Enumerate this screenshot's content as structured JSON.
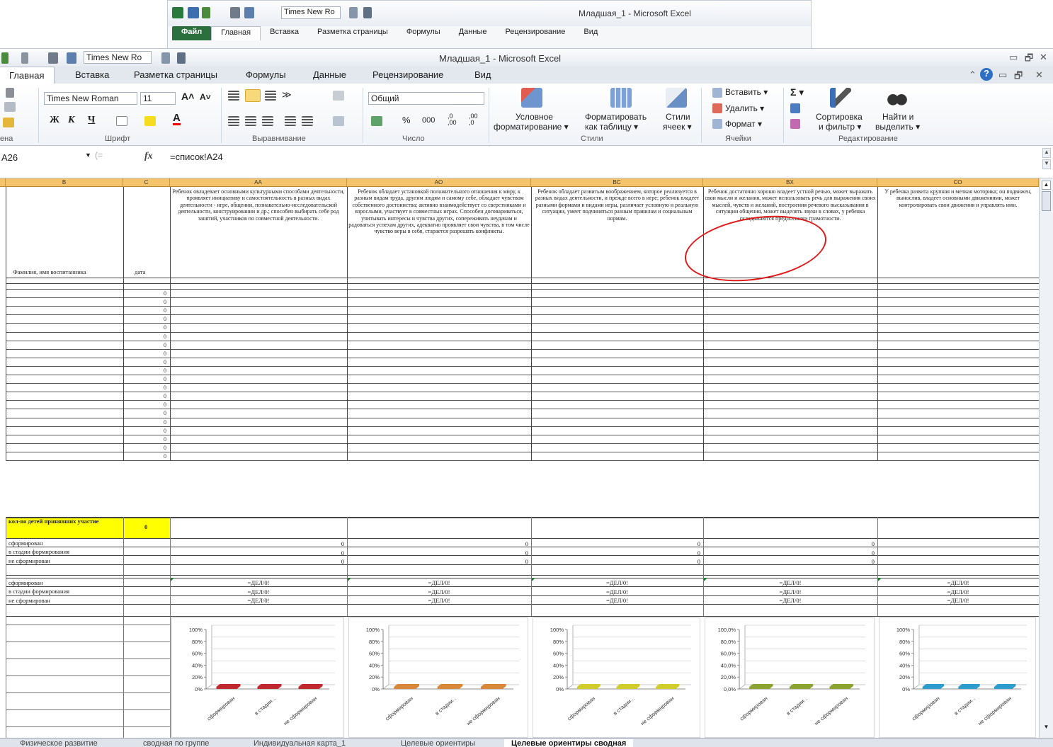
{
  "bg_window": {
    "title": "Младшая_1 - Microsoft Excel",
    "font": "Times New Ro",
    "tabs": [
      "Файл",
      "Главная",
      "Вставка",
      "Разметка страницы",
      "Формулы",
      "Данные",
      "Рецензирование",
      "Вид"
    ]
  },
  "window": {
    "title": "Младшая_1 - Microsoft Excel",
    "qat_font": "Times New Ro"
  },
  "ribbon_tabs": [
    "Главная",
    "Вставка",
    "Разметка страницы",
    "Формулы",
    "Данные",
    "Рецензирование",
    "Вид"
  ],
  "ribbon": {
    "clipboard_label": "ена",
    "font_name": "Times New Roman",
    "font_size": "11",
    "bold": "Ж",
    "italic": "К",
    "underline": "Ч",
    "font_group": "Шрифт",
    "align_group": "Выравнивание",
    "number_format": "Общий",
    "percent": "%",
    "thousands": "000",
    "number_group": "Число",
    "cond_format_1": "Условное",
    "cond_format_2": "форматирование ▾",
    "as_table_1": "Форматировать",
    "as_table_2": "как таблицу ▾",
    "cell_styles_1": "Стили",
    "cell_styles_2": "ячеек ▾",
    "styles_group": "Стили",
    "insert": "Вставить ▾",
    "delete": "Удалить ▾",
    "format": "Формат ▾",
    "cells_group": "Ячейки",
    "sigma": "Σ ▾",
    "sort_1": "Сортировка",
    "sort_2": "и фильтр ▾",
    "find_1": "Найти и",
    "find_2": "выделить ▾",
    "editing_group": "Редактирование"
  },
  "formula_bar": {
    "name_box": "A26",
    "fx": "fx",
    "formula": "=список!A24"
  },
  "columns": [
    {
      "id": "B",
      "header": "B"
    },
    {
      "id": "C",
      "header": "C"
    },
    {
      "id": "AA",
      "header": "AA",
      "text": "Ребенок овладевает основными культурными способами деятельности, проявляет инициативу и самостоятельность в разных видах деятельности - игре, общении, познавательно-исследовательской деятельности, конструировании и др.; способен выбирать себе род занятий, участников по совместной деятельности."
    },
    {
      "id": "AO",
      "header": "AO",
      "text": "Ребенок обладает установкой положительного отношения к миру, к разным видам труда, другим людям и самому себе, обладает чувством собственного достоинства; активно взаимодействует со сверстниками и взрослыми, участвует в совместных играх. Способен договариваться, учитывать интересы и чувства других, сопереживать неудачам и радоваться успехам других, адекватно проявляет свои чувства, в том числе чувство веры в себя, старается разрешать конфликты."
    },
    {
      "id": "BC",
      "header": "BC",
      "text": "Ребенок обладает развитым воображением, которое реализуется в разных видах деятельности, и прежде всего в игре; ребенок владеет разными формами и видами игры, различает условную и реальную ситуации, умеет подчиняться разным правилам и социальным нормам."
    },
    {
      "id": "BX",
      "header": "BX",
      "text": "Ребенок достаточно хорошо владеет устной речью, может выражать свои мысли и желания, может использовать речь для выражения своих мыслей, чувств и желаний, построения речевого высказывания в ситуации общения, может выделять звуки в словах, у ребенка складываются предпосылки грамотности."
    },
    {
      "id": "CO",
      "header": "CO",
      "text": "У ребенка развита крупная и мелкая моторика; он подвижен, вынослив, владеет основными движениями, может контролировать свои движения и управлять ими."
    }
  ],
  "header_labels": {
    "name_col": "Фамилия, имя воспитанника",
    "date_col": "дата"
  },
  "zero_values": [
    "0",
    "0",
    "0",
    "0",
    "0",
    "0",
    "0",
    "0",
    "0",
    "0",
    "0",
    "0",
    "0",
    "0",
    "0",
    "0",
    "0",
    "0",
    "0",
    "0"
  ],
  "summary": {
    "count_label": "кол-во детей принявших участие",
    "count_value": "0",
    "rows": [
      {
        "label": "сформирован",
        "value": "0"
      },
      {
        "label": "в стадии формирования",
        "value": "0"
      },
      {
        "label": "не сформирован",
        "value": "0"
      }
    ],
    "pct_rows": [
      {
        "label": "сформирован",
        "value": "=ДЕЛ/0!"
      },
      {
        "label": "в стадии формирования",
        "value": "=ДЕЛ/0!"
      },
      {
        "label": "не сформирован",
        "value": "=ДЕЛ/0!"
      }
    ]
  },
  "chart_data": [
    {
      "type": "bar",
      "categories": [
        "сформирован",
        "в стадии...",
        "не сформирован"
      ],
      "values": [
        0,
        0,
        0
      ],
      "ylim": [
        0,
        100
      ],
      "yticks": [
        "100%",
        "80%",
        "60%",
        "40%",
        "20%",
        "0%"
      ],
      "color": "#c0282d"
    },
    {
      "type": "bar",
      "categories": [
        "сформирован",
        "в стадии...",
        "не сформирован"
      ],
      "values": [
        0,
        0,
        0
      ],
      "ylim": [
        0,
        100
      ],
      "yticks": [
        "100%",
        "80%",
        "60%",
        "40%",
        "20%",
        "0%"
      ],
      "color": "#d9883a"
    },
    {
      "type": "bar",
      "categories": [
        "сформирован",
        "в стадии...",
        "не сформирован"
      ],
      "values": [
        0,
        0,
        0
      ],
      "ylim": [
        0,
        100
      ],
      "yticks": [
        "100%",
        "80%",
        "60%",
        "40%",
        "20%",
        "0%"
      ],
      "color": "#d0cc2a"
    },
    {
      "type": "bar",
      "categories": [
        "сформирован",
        "в стадии...",
        "не сформирован"
      ],
      "values": [
        0,
        0,
        0
      ],
      "ylim": [
        0,
        100
      ],
      "yticks": [
        "100,0%",
        "80,0%",
        "60,0%",
        "40,0%",
        "20,0%",
        "0,0%"
      ],
      "color": "#8ba430"
    },
    {
      "type": "bar",
      "categories": [
        "сформирован",
        "в стадии...",
        "не сформирован"
      ],
      "values": [
        0,
        0,
        0
      ],
      "ylim": [
        0,
        100
      ],
      "yticks": [
        "100%",
        "80%",
        "60%",
        "40%",
        "20%",
        "0%"
      ],
      "color": "#2e9ccc"
    }
  ],
  "sheet_tabs": [
    {
      "label": "Физическое развитие",
      "active": false
    },
    {
      "label": "сводная по группе",
      "active": false
    },
    {
      "label": "Индивидуальная карта_1",
      "active": false
    },
    {
      "label": "Целевые ориентиры",
      "active": false
    },
    {
      "label": "Целевые ориентиры сводная",
      "active": true
    }
  ]
}
